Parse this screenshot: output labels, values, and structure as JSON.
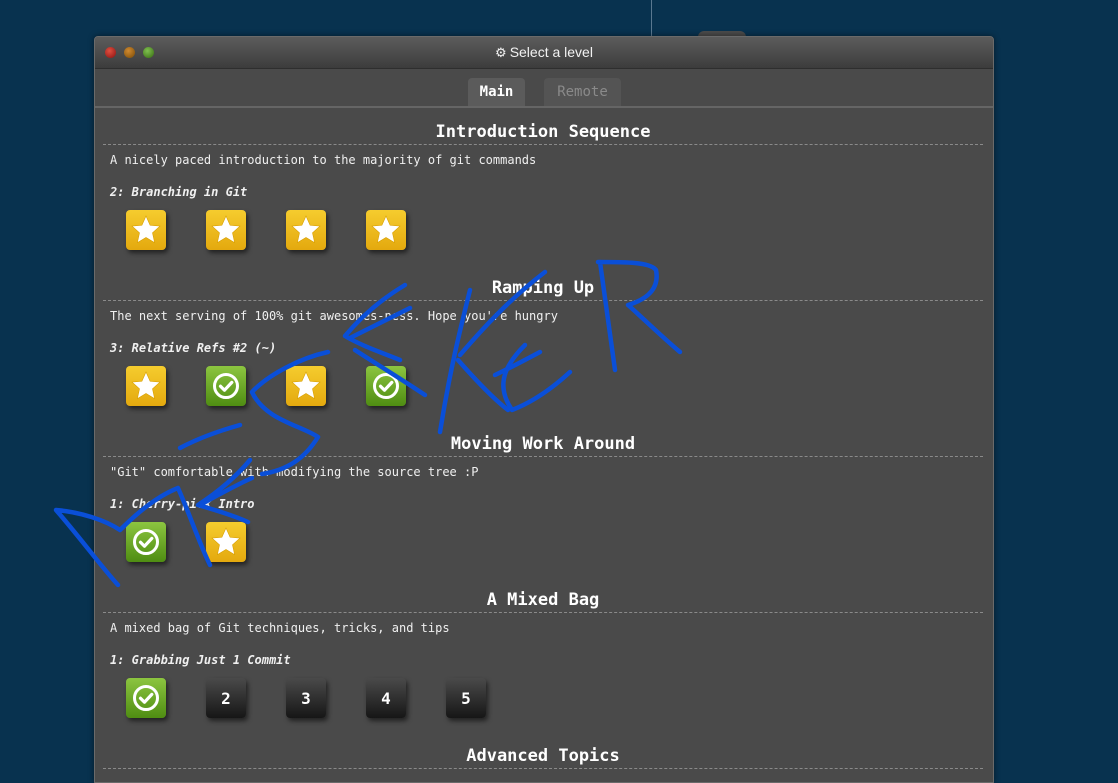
{
  "window": {
    "title": "Select a level",
    "title_icon": "gear-icon"
  },
  "tabs": [
    {
      "label": "Main",
      "active": true
    },
    {
      "label": "Remote",
      "active": false
    }
  ],
  "sections": [
    {
      "title": "Introduction Sequence",
      "description": "A nicely paced introduction to the majority of git commands",
      "current_level": "2: Branching in Git",
      "levels": [
        {
          "kind": "star",
          "icon": "star-icon"
        },
        {
          "kind": "star",
          "icon": "star-icon"
        },
        {
          "kind": "star",
          "icon": "star-icon"
        },
        {
          "kind": "star",
          "icon": "star-icon"
        }
      ]
    },
    {
      "title": "Ramping Up",
      "description": "The next serving of 100% git awesomes-ness. Hope you're hungry",
      "current_level": "3: Relative Refs #2 (~)",
      "levels": [
        {
          "kind": "star",
          "icon": "star-icon"
        },
        {
          "kind": "check",
          "icon": "checkmark-icon"
        },
        {
          "kind": "star",
          "icon": "star-icon"
        },
        {
          "kind": "check",
          "icon": "checkmark-icon"
        }
      ]
    },
    {
      "title": "Moving Work Around",
      "description": "\"Git\" comfortable with modifying the source tree :P",
      "current_level": "1: Cherry-pick Intro",
      "levels": [
        {
          "kind": "check",
          "icon": "checkmark-icon"
        },
        {
          "kind": "star",
          "icon": "star-icon"
        }
      ]
    },
    {
      "title": "A Mixed Bag",
      "description": "A mixed bag of Git techniques, tricks, and tips",
      "current_level": "1: Grabbing Just 1 Commit",
      "levels": [
        {
          "kind": "check",
          "icon": "checkmark-icon"
        },
        {
          "kind": "num",
          "label": "2"
        },
        {
          "kind": "num",
          "label": "3"
        },
        {
          "kind": "num",
          "label": "4"
        },
        {
          "kind": "num",
          "label": "5"
        }
      ]
    },
    {
      "title": "Advanced Topics",
      "description": "",
      "current_level": "",
      "levels": []
    }
  ],
  "overlay": {
    "scribble_text": "MESEKER",
    "color": "#0a4fd8"
  },
  "colors": {
    "star": "#f2c022",
    "check": "#6aab2a",
    "background": "#08324f",
    "panel": "#4a4a4a"
  }
}
